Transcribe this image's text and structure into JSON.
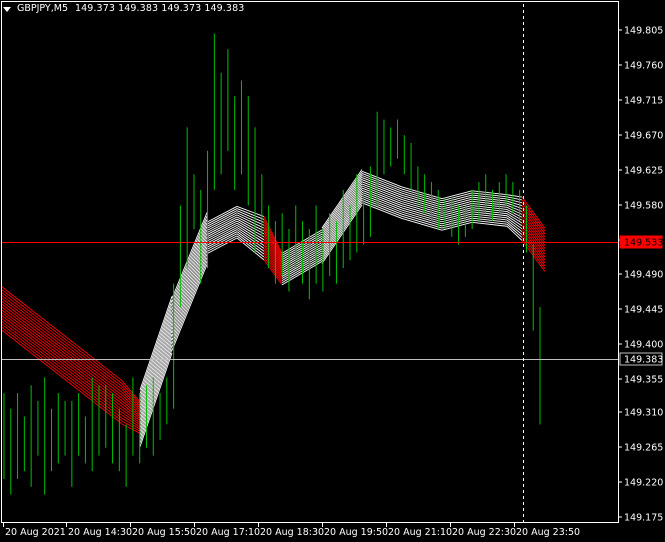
{
  "window": {
    "symbol": "GBPJPY,M5",
    "open": "149.373",
    "high": "149.383",
    "low": "149.373",
    "close": "149.383"
  },
  "colors": {
    "background": "#000000",
    "axis": "#ffffff",
    "bull_bar": "#00c000",
    "ribbon_up": "#ffffff",
    "ribbon_down": "#ff0000",
    "h_line_red": "#ff0000",
    "h_line_grey": "#c0c0c0",
    "price_label_red": "#ff0000",
    "price_label_dark": "#000000"
  },
  "icons": {
    "collapse": "triangle-down-icon"
  },
  "chart_data": {
    "type": "candlestick-bars",
    "symbol": "GBPJPY",
    "timeframe": "M5",
    "ylim": [
      149.175,
      149.82
    ],
    "y_ticks": [
      "149.805",
      "149.760",
      "149.715",
      "149.670",
      "149.625",
      "149.580",
      "149.535",
      "149.490",
      "149.445",
      "149.400",
      "149.355",
      "149.310",
      "149.265",
      "149.220",
      "149.175"
    ],
    "x_ticks": [
      "20 Aug 2021",
      "20 Aug 14:30",
      "20 Aug 15:50",
      "20 Aug 17:10",
      "20 Aug 18:30",
      "20 Aug 19:50",
      "20 Aug 21:10",
      "20 Aug 22:30",
      "20 Aug 23:50"
    ],
    "horizontal_lines": [
      {
        "price": 149.533,
        "label": "149.533",
        "color": "#ff0000"
      },
      {
        "price": 149.383,
        "label": "149.383",
        "color": "#c0c0c0"
      }
    ],
    "ribbon": {
      "lines": 16,
      "segments": [
        {
          "x": 0,
          "y": 149.45,
          "trend": "down"
        },
        {
          "x": 60,
          "y": 149.39,
          "trend": "down"
        },
        {
          "x": 120,
          "y": 149.33,
          "trend": "down"
        },
        {
          "x": 138,
          "y": 149.31,
          "trend": "up"
        },
        {
          "x": 170,
          "y": 149.43,
          "trend": "up"
        },
        {
          "x": 205,
          "y": 149.54,
          "trend": "up"
        },
        {
          "x": 235,
          "y": 149.56,
          "trend": "up"
        },
        {
          "x": 262,
          "y": 149.54,
          "trend": "down"
        },
        {
          "x": 280,
          "y": 149.5,
          "trend": "up"
        },
        {
          "x": 320,
          "y": 149.53,
          "trend": "up"
        },
        {
          "x": 360,
          "y": 149.605,
          "trend": "up"
        },
        {
          "x": 400,
          "y": 149.585,
          "trend": "up"
        },
        {
          "x": 440,
          "y": 149.57,
          "trend": "up"
        },
        {
          "x": 470,
          "y": 149.58,
          "trend": "up"
        },
        {
          "x": 505,
          "y": 149.575,
          "trend": "up"
        },
        {
          "x": 520,
          "y": 149.565,
          "trend": "down"
        },
        {
          "x": 543,
          "y": 149.525,
          "trend": "down"
        }
      ]
    },
    "bars": [
      [
        149.23,
        149.34
      ],
      [
        149.21,
        149.32
      ],
      [
        149.23,
        149.34
      ],
      [
        149.24,
        149.31
      ],
      [
        149.22,
        149.35
      ],
      [
        149.26,
        149.33
      ],
      [
        149.21,
        149.36
      ],
      [
        149.24,
        149.32
      ],
      [
        149.25,
        149.34
      ],
      [
        149.26,
        149.33
      ],
      [
        149.22,
        149.33
      ],
      [
        149.26,
        149.34
      ],
      [
        149.25,
        149.31
      ],
      [
        149.24,
        149.36
      ],
      [
        149.26,
        149.35
      ],
      [
        149.27,
        149.35
      ],
      [
        149.25,
        149.34
      ],
      [
        149.24,
        149.32
      ],
      [
        149.22,
        149.3
      ],
      [
        149.26,
        149.36
      ],
      [
        149.25,
        149.34
      ],
      [
        149.27,
        149.35
      ],
      [
        149.26,
        149.36
      ],
      [
        149.28,
        149.34
      ],
      [
        149.3,
        149.36
      ],
      [
        149.32,
        149.48
      ],
      [
        149.45,
        149.58
      ],
      [
        149.5,
        149.68
      ],
      [
        149.55,
        149.62
      ],
      [
        149.48,
        149.6
      ],
      [
        149.5,
        149.65
      ],
      [
        149.6,
        149.8
      ],
      [
        149.62,
        149.75
      ],
      [
        149.65,
        149.78
      ],
      [
        149.6,
        149.72
      ],
      [
        149.62,
        149.74
      ],
      [
        149.58,
        149.72
      ],
      [
        149.52,
        149.68
      ],
      [
        149.54,
        149.62
      ],
      [
        149.5,
        149.58
      ],
      [
        149.48,
        149.56
      ],
      [
        149.49,
        149.57
      ],
      [
        149.47,
        149.55
      ],
      [
        149.5,
        149.58
      ],
      [
        149.48,
        149.56
      ],
      [
        149.46,
        149.55
      ],
      [
        149.48,
        149.58
      ],
      [
        149.47,
        149.55
      ],
      [
        149.49,
        149.57
      ],
      [
        149.48,
        149.56
      ],
      [
        149.5,
        149.6
      ],
      [
        149.51,
        149.58
      ],
      [
        149.52,
        149.62
      ],
      [
        149.53,
        149.6
      ],
      [
        149.54,
        149.63
      ],
      [
        149.58,
        149.7
      ],
      [
        149.62,
        149.69
      ],
      [
        149.63,
        149.68
      ],
      [
        149.64,
        149.69
      ],
      [
        149.62,
        149.67
      ],
      [
        149.6,
        149.66
      ],
      [
        149.58,
        149.63
      ],
      [
        149.57,
        149.62
      ],
      [
        149.56,
        149.61
      ],
      [
        149.55,
        149.6
      ],
      [
        149.55,
        149.59
      ],
      [
        149.54,
        149.59
      ],
      [
        149.53,
        149.58
      ],
      [
        149.54,
        149.58
      ],
      [
        149.55,
        149.6
      ],
      [
        149.56,
        149.61
      ],
      [
        149.57,
        149.62
      ],
      [
        149.56,
        149.6
      ],
      [
        149.57,
        149.61
      ],
      [
        149.58,
        149.62
      ],
      [
        149.57,
        149.61
      ],
      [
        149.56,
        149.6
      ],
      [
        149.52,
        149.58
      ],
      [
        149.42,
        149.53
      ],
      [
        149.3,
        149.45
      ]
    ]
  }
}
